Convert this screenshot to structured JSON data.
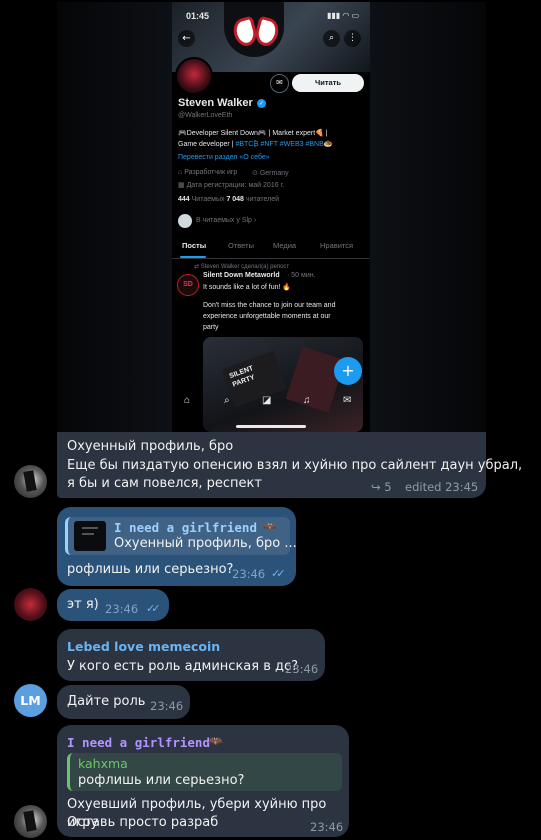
{
  "screenshot": {
    "status_time": "01:45",
    "profile_name": "Steven Walker",
    "handle": "@WalkerLoveEth",
    "read_button": "Читать",
    "bio_line1": "🎮Developer Silent Down🎮 | Market expert🍕 |",
    "bio_line2_prefix": "Game developer | ",
    "bio_tags": "#BTC₿ #NFT #WEB3 #BNB🧆",
    "translate_link": "Перевести раздел «О себе»",
    "category": "Разработчик игр",
    "location": "Germany",
    "joined": "Дата регистрации: май 2016 г.",
    "following_count": "444",
    "following_label": "Читаемых",
    "followers_count": "7 048",
    "followers_label": "читателей",
    "followed_by": "В читаемых у Slp ›",
    "tabs": [
      "Посты",
      "Ответы",
      "Медиа",
      "Нравится"
    ],
    "repost_note": "Steven Walker сделал(а) репост",
    "post_author": "Silent Down Metaworld",
    "post_time": "· 50 мин.",
    "post_line1": "It sounds like a lot of fun! 🔥",
    "post_line2": "Don't miss the chance to join our team and",
    "post_line3": "experience unforgettable moments at our",
    "post_line4": "party",
    "ticket_text": "SILENT PARTY",
    "fab_icon": "plus-icon"
  },
  "messages": {
    "m1_line1": "Охуенный профиль, бро",
    "m1_line2": "Еще бы пиздатую опенсию взял и хуйню про сайлент даун убрал,",
    "m1_line3": "я бы и сам повелся, респект",
    "m1_replies": "5",
    "m1_meta": "edited 23:45",
    "m2_reply_name": "I need a girlfriend",
    "m2_reply_text": "Охуенный профиль, бро ...",
    "m2_text": "рофлишь или серьезно?",
    "m2_time": "23:46",
    "m3_text": "эт я)",
    "m3_time": "23:46",
    "m4_name": "Lebed love memecoin",
    "m4_text": "У кого есть роль админская в дс?",
    "m4_time": "23:46",
    "m5_text": "Дайте роль",
    "m5_time": "23:46",
    "m5_avatar": "LM",
    "m6_name": "I need a girlfriend",
    "m6_reply_name": "kahxma",
    "m6_reply_text": "рофлишь или серьезно?",
    "m6_line1": "Охуевший профиль, убери хуйню про игру",
    "m6_line2": "Оставь просто разраб",
    "m6_time": "23:46"
  },
  "colors": {
    "bubble": "#2b3440",
    "twitter_blue": "#1d9bf0",
    "name_blue": "#6ab3f3",
    "name_purple": "#b294ff",
    "reply_green": "#6bc46d"
  }
}
